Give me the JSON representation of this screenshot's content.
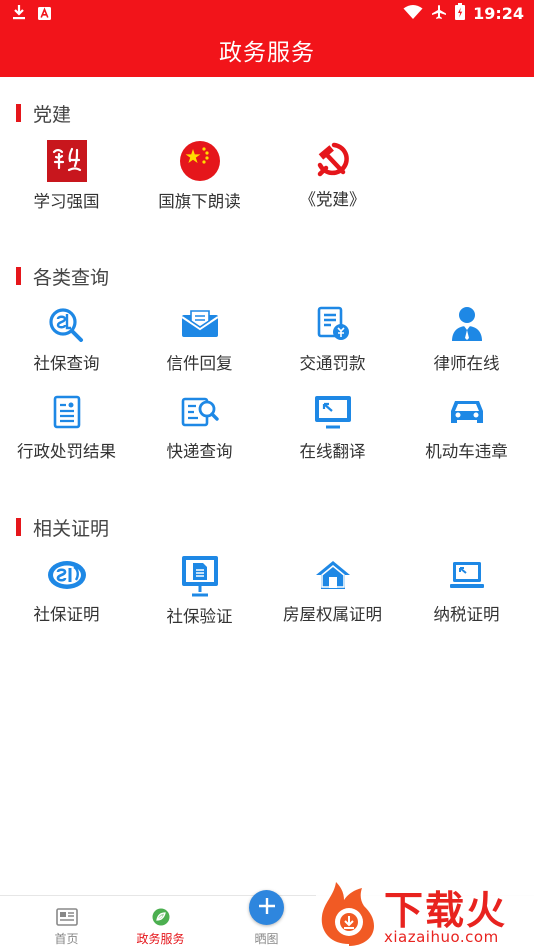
{
  "status_bar": {
    "time": "19:24"
  },
  "header": {
    "title": "政务服务"
  },
  "sections": [
    {
      "title": "党建",
      "items": [
        {
          "label": "学习强国",
          "icon": "xuexi-logo-icon"
        },
        {
          "label": "国旗下朗读",
          "icon": "china-flag-icon"
        },
        {
          "label": "《党建》",
          "icon": "hammer-sickle-icon"
        }
      ]
    },
    {
      "title": "各类查询",
      "items": [
        {
          "label": "社保查询",
          "icon": "social-security-search-icon"
        },
        {
          "label": "信件回复",
          "icon": "envelope-icon"
        },
        {
          "label": "交通罚款",
          "icon": "fine-document-icon"
        },
        {
          "label": "律师在线",
          "icon": "lawyer-icon"
        },
        {
          "label": "行政处罚结果",
          "icon": "document-icon"
        },
        {
          "label": "快递查询",
          "icon": "parcel-search-icon"
        },
        {
          "label": "在线翻译",
          "icon": "monitor-icon"
        },
        {
          "label": "机动车违章",
          "icon": "car-icon"
        }
      ]
    },
    {
      "title": "相关证明",
      "items": [
        {
          "label": "社保证明",
          "icon": "si-logo-icon"
        },
        {
          "label": "社保验证",
          "icon": "display-stand-icon"
        },
        {
          "label": "房屋权属证明",
          "icon": "house-icon"
        },
        {
          "label": "纳税证明",
          "icon": "laptop-icon"
        }
      ]
    }
  ],
  "bottom_nav": [
    {
      "label": "首页",
      "icon": "newspaper-icon",
      "active": false
    },
    {
      "label": "政务服务",
      "icon": "leaf-icon",
      "active": true
    },
    {
      "label": "晒图",
      "icon": "plus-icon",
      "active": false
    }
  ],
  "watermark": {
    "brand": "下载火",
    "url": "xiazaihuo.com"
  },
  "colors": {
    "primary_red": "#f2141a",
    "icon_blue": "#1e88e5",
    "fab_blue": "#2e86de",
    "active_green": "#4caf50"
  }
}
